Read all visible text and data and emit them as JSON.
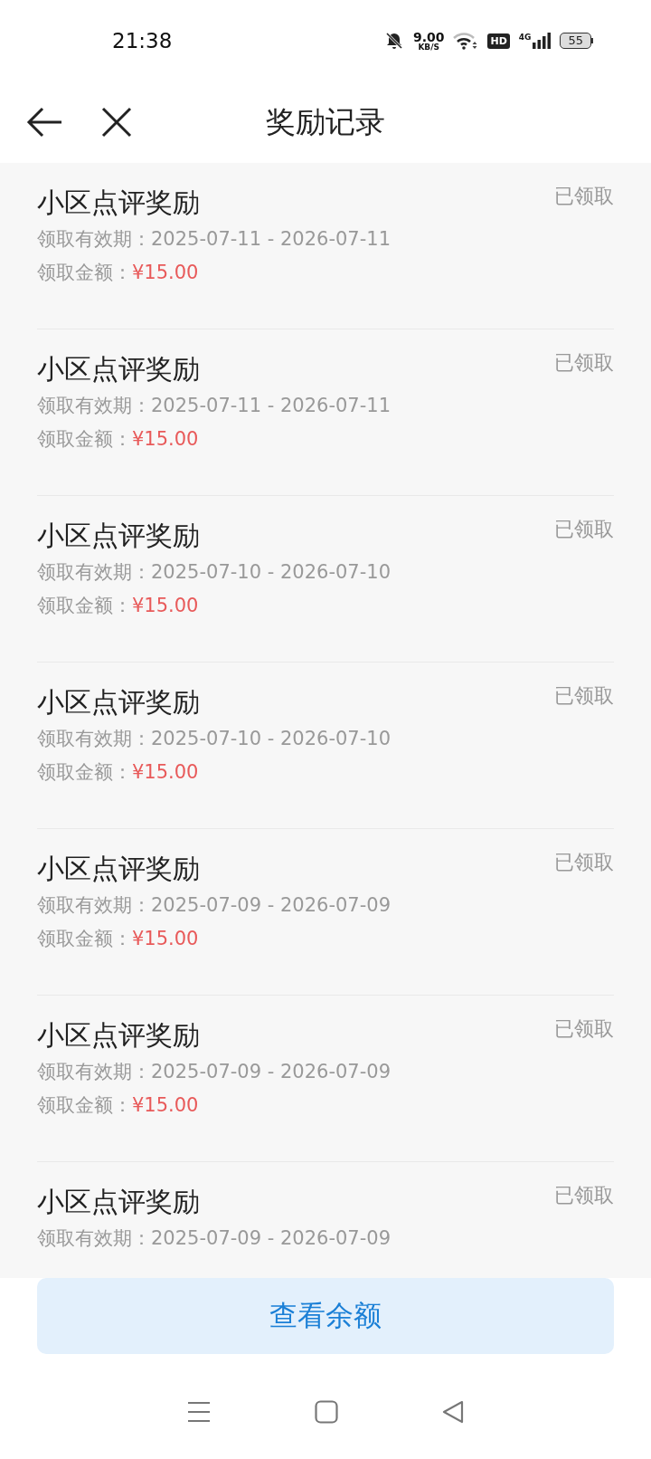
{
  "status_bar": {
    "time": "21:38",
    "net_speed": "9.00",
    "net_unit": "KB/S",
    "hd": "HD",
    "network": "4G",
    "battery": "55"
  },
  "header": {
    "title": "奖励记录"
  },
  "records": [
    {
      "title": "小区点评奖励",
      "status": "已领取",
      "validity_label": "领取有效期：",
      "validity": "2025-07-11 - 2026-07-11",
      "amount_label": "领取金额：",
      "amount": "¥15.00"
    },
    {
      "title": "小区点评奖励",
      "status": "已领取",
      "validity_label": "领取有效期：",
      "validity": "2025-07-11 - 2026-07-11",
      "amount_label": "领取金额：",
      "amount": "¥15.00"
    },
    {
      "title": "小区点评奖励",
      "status": "已领取",
      "validity_label": "领取有效期：",
      "validity": "2025-07-10 - 2026-07-10",
      "amount_label": "领取金额：",
      "amount": "¥15.00"
    },
    {
      "title": "小区点评奖励",
      "status": "已领取",
      "validity_label": "领取有效期：",
      "validity": "2025-07-10 - 2026-07-10",
      "amount_label": "领取金额：",
      "amount": "¥15.00"
    },
    {
      "title": "小区点评奖励",
      "status": "已领取",
      "validity_label": "领取有效期：",
      "validity": "2025-07-09 - 2026-07-09",
      "amount_label": "领取金额：",
      "amount": "¥15.00"
    },
    {
      "title": "小区点评奖励",
      "status": "已领取",
      "validity_label": "领取有效期：",
      "validity": "2025-07-09 - 2026-07-09",
      "amount_label": "领取金额：",
      "amount": "¥15.00"
    },
    {
      "title": "小区点评奖励",
      "status": "已领取",
      "validity_label": "领取有效期：",
      "validity": "2025-07-09 - 2026-07-09"
    }
  ],
  "balance_button": "查看余额"
}
